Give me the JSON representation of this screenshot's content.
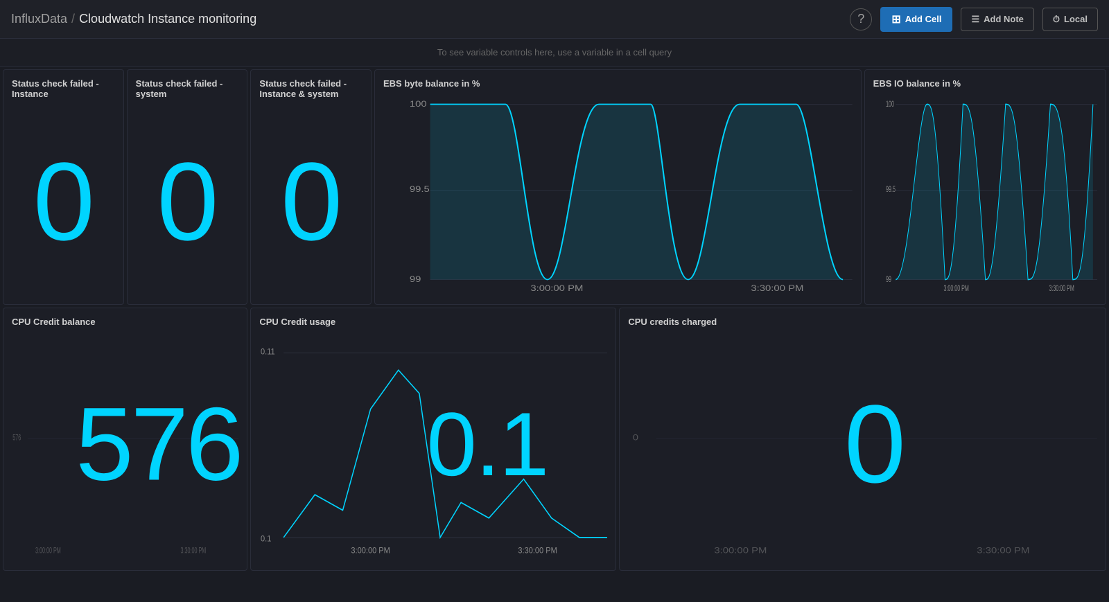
{
  "header": {
    "org": "InfluxData",
    "separator": "/",
    "title": "Cloudwatch Instance monitoring",
    "help_label": "?",
    "add_cell_label": "Add Cell",
    "add_note_label": "Add Note",
    "local_label": "Local"
  },
  "variable_bar": {
    "message": "To see variable controls here, use a variable in a cell query"
  },
  "cells": {
    "status_instance": {
      "title": "Status check failed - Instance",
      "value": "0"
    },
    "status_system": {
      "title": "Status check failed - system",
      "value": "0"
    },
    "status_both": {
      "title": "Status check failed - Instance & system",
      "value": "0"
    },
    "ebs_byte": {
      "title": "EBS byte balance in %",
      "y_max": "100",
      "y_mid": "99.5",
      "y_min": "99",
      "time_start": "3:00:00 PM",
      "time_end": "3:30:00 PM"
    },
    "ebs_io": {
      "title": "EBS IO balance in %",
      "y_max": "100",
      "y_mid": "99.5",
      "y_min": "99",
      "time_start": "3:00:00 PM",
      "time_end": "3:30:00 PM"
    },
    "cpu_credit_bal": {
      "title": "CPU Credit balance",
      "value": "576",
      "y_val": "576",
      "time_start": "3:00:00 PM",
      "time_end": "3:30:00 PM"
    },
    "cpu_credit_use": {
      "title": "CPU Credit usage",
      "value": "0.1",
      "y_max": "0.11",
      "y_min": "0.1",
      "time_start": "3:00:00 PM",
      "time_end": "3:30:00 PM"
    },
    "cpu_charged": {
      "title": "CPU credits charged",
      "value": "0",
      "y_val": "0",
      "time_start": "3:00:00 PM",
      "time_end": "3:30:00 PM"
    }
  }
}
